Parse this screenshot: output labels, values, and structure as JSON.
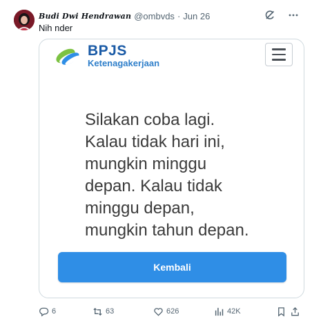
{
  "tweet": {
    "author_name": "Budi Dwi Hendrawan",
    "handle": "@ombvds",
    "separator": "·",
    "date": "Jun 26",
    "text": "Nih nder"
  },
  "media": {
    "logo_title": "BPJS",
    "logo_subtitle": "Ketenagakerjaan",
    "message": "Silakan coba lagi.\nKalau tidak hari ini,\nmungkin minggu\ndepan. Kalau tidak\nminggu depan,\nmungkin tahun depan.",
    "button_label": "Kembali",
    "button_color": "#2f8ee6"
  },
  "actions": {
    "replies": "6",
    "retweets": "63",
    "likes": "626",
    "views": "42K"
  }
}
